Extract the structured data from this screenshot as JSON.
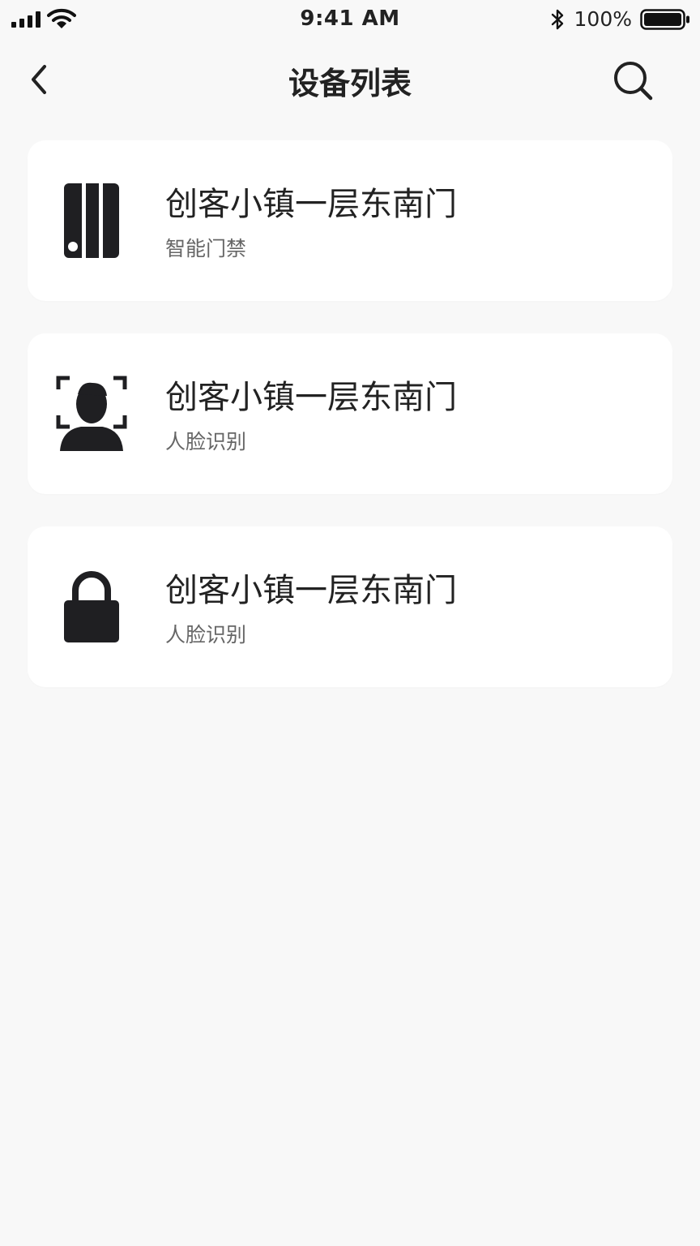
{
  "status_bar": {
    "time": "9:41 AM",
    "battery_text": "100%",
    "icons": [
      "signal-icon",
      "wifi-icon",
      "bluetooth-icon",
      "battery-icon"
    ]
  },
  "nav": {
    "title": "设备列表",
    "back_icon": "chevron-left-icon",
    "search_icon": "search-icon"
  },
  "devices": [
    {
      "name": "创客小镇一层东南门",
      "type": "智能门禁",
      "icon": "door-access-icon"
    },
    {
      "name": "创客小镇一层东南门",
      "type": "人脸识别",
      "icon": "face-recognition-icon"
    },
    {
      "name": "创客小镇一层东南门",
      "type": "人脸识别",
      "icon": "lock-icon"
    }
  ],
  "colors": {
    "background": "#f8f8f8",
    "card": "#ffffff",
    "text_primary": "#222222",
    "text_secondary": "#666666"
  }
}
